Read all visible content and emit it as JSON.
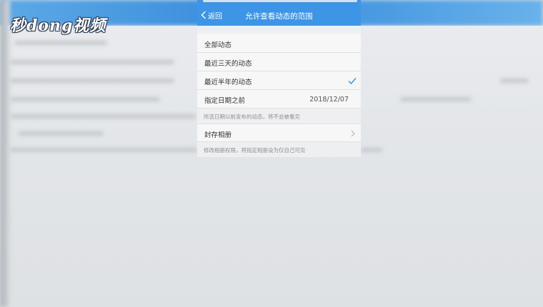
{
  "watermark": {
    "text": "秒dong视频"
  },
  "header": {
    "back_label": "返回",
    "title": "允许查看动态的范围",
    "color": "#3d95e6"
  },
  "options": [
    {
      "label": "全部动态",
      "selected": false
    },
    {
      "label": "最近三天的动态",
      "selected": false
    },
    {
      "label": "最近半年的动态",
      "selected": true
    }
  ],
  "date_row": {
    "label": "指定日期之前",
    "value": "2018/12/07"
  },
  "date_note": "所选日期以前发布的动态，将不会被看见",
  "archive_row": {
    "label": "封存相册"
  },
  "archive_note": "修改相册权限，将指定相册设为仅自己可见",
  "colors": {
    "accent": "#3d95e6",
    "check": "#3d95e6"
  }
}
